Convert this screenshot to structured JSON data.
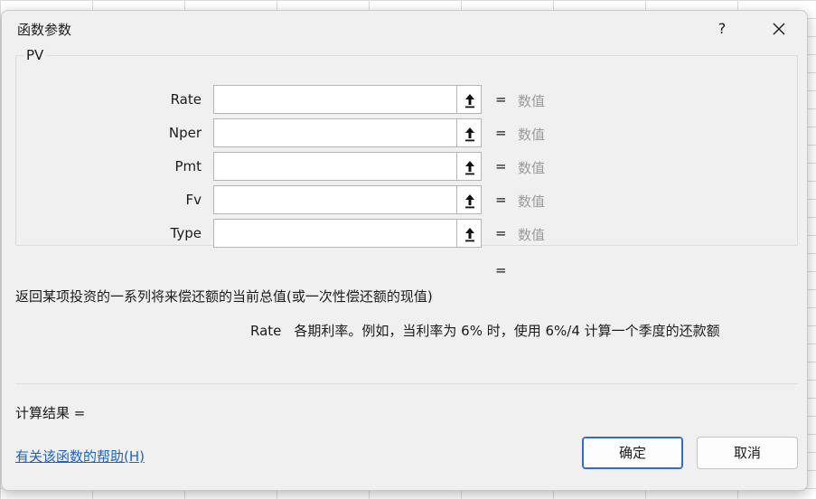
{
  "dialog": {
    "title": "函数参数",
    "help_glyph": "?",
    "close_icon": "close-icon"
  },
  "function": {
    "name": "PV",
    "args": [
      {
        "label": "Rate",
        "value": "",
        "eq": "=",
        "type_hint": "数值"
      },
      {
        "label": "Nper",
        "value": "",
        "eq": "=",
        "type_hint": "数值"
      },
      {
        "label": "Pmt",
        "value": "",
        "eq": "=",
        "type_hint": "数值"
      },
      {
        "label": "Fv",
        "value": "",
        "eq": "=",
        "type_hint": "数值"
      },
      {
        "label": "Type",
        "value": "",
        "eq": "=",
        "type_hint": "数值"
      }
    ],
    "result_eq": "=",
    "description": "返回某项投资的一系列将来偿还额的当前总值(或一次性偿还额的现值)",
    "current_arg": {
      "name": "Rate",
      "text": "各期利率。例如，当利率为 6% 时，使用 6%/4 计算一个季度的还款额"
    }
  },
  "footer": {
    "calc_result_label": "计算结果 =",
    "help_link": "有关该函数的帮助(H)",
    "ok_label": "确定",
    "cancel_label": "取消"
  },
  "colors": {
    "dialog_bg": "#f0f0f0",
    "link": "#1a63c7",
    "primary_border": "#2c6fc7",
    "hint": "#9a9a9a"
  }
}
